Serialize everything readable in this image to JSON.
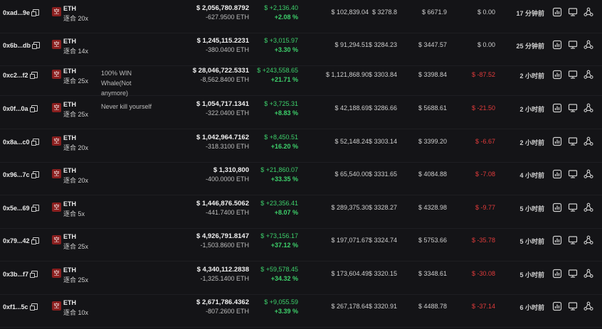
{
  "rows": [
    {
      "addr": "0xad...9e",
      "coin": "ETH",
      "side": "空",
      "lev": "逐合 20x",
      "note": "",
      "pos": "$ 2,056,780.8792",
      "qty": "-627.9500 ETH",
      "pnl": "$ +2,136.40",
      "pct": "+2.08 %",
      "val": "$ 102,839.04",
      "entry": "$ 3278.8",
      "liq": "$ 6671.9",
      "fund": "$ 0.00",
      "fund_neg": false,
      "time": "17 分钟前"
    },
    {
      "addr": "0x6b...db",
      "coin": "ETH",
      "side": "空",
      "lev": "逐合 14x",
      "note": "",
      "pos": "$ 1,245,115.2231",
      "qty": "-380.0400 ETH",
      "pnl": "$ +3,015.97",
      "pct": "+3.30 %",
      "val": "$ 91,294.51",
      "entry": "$ 3284.23",
      "liq": "$ 3447.57",
      "fund": "$ 0.00",
      "fund_neg": false,
      "time": "25 分钟前"
    },
    {
      "addr": "0xc2...f2",
      "coin": "ETH",
      "side": "空",
      "lev": "逐合 25x",
      "note": "100% WIN Whale(Not anymore)",
      "pos": "$ 28,046,722.5331",
      "qty": "-8,562.8400 ETH",
      "pnl": "$ +243,558.65",
      "pct": "+21.71 %",
      "val": "$ 1,121,868.90",
      "entry": "$ 3303.84",
      "liq": "$ 3398.84",
      "fund": "$ -87.52",
      "fund_neg": true,
      "time": "2 小时前"
    },
    {
      "addr": "0x0f...0a",
      "coin": "ETH",
      "side": "空",
      "lev": "逐合 25x",
      "note": "Never kill yourself",
      "pos": "$ 1,054,717.1341",
      "qty": "-322.0400 ETH",
      "pnl": "$ +3,725.31",
      "pct": "+8.83 %",
      "val": "$ 42,188.69",
      "entry": "$ 3286.66",
      "liq": "$ 5688.61",
      "fund": "$ -21.50",
      "fund_neg": true,
      "time": "2 小时前"
    },
    {
      "addr": "0x8a...c0",
      "coin": "ETH",
      "side": "空",
      "lev": "逐合 20x",
      "note": "",
      "pos": "$ 1,042,964.7162",
      "qty": "-318.3100 ETH",
      "pnl": "$ +8,450.51",
      "pct": "+16.20 %",
      "val": "$ 52,148.24",
      "entry": "$ 3303.14",
      "liq": "$ 3399.20",
      "fund": "$ -6.67",
      "fund_neg": true,
      "time": "2 小时前"
    },
    {
      "addr": "0x96...7c",
      "coin": "ETH",
      "side": "空",
      "lev": "逐合 20x",
      "note": "",
      "pos": "$ 1,310,800",
      "qty": "-400.0000 ETH",
      "pnl": "$ +21,860.07",
      "pct": "+33.35 %",
      "val": "$ 65,540.00",
      "entry": "$ 3331.65",
      "liq": "$ 4084.88",
      "fund": "$ -7.08",
      "fund_neg": true,
      "time": "4 小时前"
    },
    {
      "addr": "0x5e...69",
      "coin": "ETH",
      "side": "空",
      "lev": "逐合 5x",
      "note": "",
      "pos": "$ 1,446,876.5062",
      "qty": "-441.7400 ETH",
      "pnl": "$ +23,356.41",
      "pct": "+8.07 %",
      "val": "$ 289,375.30",
      "entry": "$ 3328.27",
      "liq": "$ 4328.98",
      "fund": "$ -9.77",
      "fund_neg": true,
      "time": "5 小时前"
    },
    {
      "addr": "0x79...42",
      "coin": "ETH",
      "side": "空",
      "lev": "逐合 25x",
      "note": "",
      "pos": "$ 4,926,791.8147",
      "qty": "-1,503.8600 ETH",
      "pnl": "$ +73,156.17",
      "pct": "+37.12 %",
      "val": "$ 197,071.67",
      "entry": "$ 3324.74",
      "liq": "$ 5753.66",
      "fund": "$ -35.78",
      "fund_neg": true,
      "time": "5 小时前"
    },
    {
      "addr": "0x3b...f7",
      "coin": "ETH",
      "side": "空",
      "lev": "逐合 25x",
      "note": "",
      "pos": "$ 4,340,112.2838",
      "qty": "-1,325.1400 ETH",
      "pnl": "$ +59,578.45",
      "pct": "+34.32 %",
      "val": "$ 173,604.49",
      "entry": "$ 3320.15",
      "liq": "$ 3348.61",
      "fund": "$ -30.08",
      "fund_neg": true,
      "time": "5 小时前"
    },
    {
      "addr": "0xf1...5c",
      "coin": "ETH",
      "side": "空",
      "lev": "逐合 10x",
      "note": "",
      "pos": "$ 2,671,786.4362",
      "qty": "-807.2600 ETH",
      "pnl": "$ +9,055.59",
      "pct": "+3.39 %",
      "val": "$ 267,178.64",
      "entry": "$ 3320.91",
      "liq": "$ 4488.78",
      "fund": "$ -37.14",
      "fund_neg": true,
      "time": "6 小时前"
    }
  ],
  "icons": [
    "chart-icon",
    "monitor-icon",
    "share-icon"
  ],
  "colors": {
    "positive": "#3dd16b",
    "negative": "#e23b3b",
    "badge": "#8a1f1f",
    "background": "#141417"
  }
}
